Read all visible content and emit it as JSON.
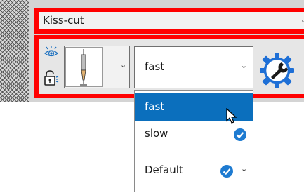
{
  "material": {
    "selected": "Kiss-cut"
  },
  "tool": {
    "image_alt": "cutting tool"
  },
  "speed": {
    "selected": "fast",
    "options": [
      {
        "label": "fast",
        "highlighted": true,
        "checked": false
      },
      {
        "label": "slow",
        "highlighted": false,
        "checked": true
      }
    ],
    "default": {
      "label": "Default",
      "checked": true
    }
  },
  "colors": {
    "frame": "#ff0000",
    "highlight": "#0b6fbd",
    "check": "#1e7bd1"
  },
  "icons": {
    "visibility": "eye-icon",
    "lock": "unlock-icon",
    "settings": "gear-wrench-icon",
    "check": "check-circle-icon",
    "cursor": "mouse-pointer-icon"
  }
}
